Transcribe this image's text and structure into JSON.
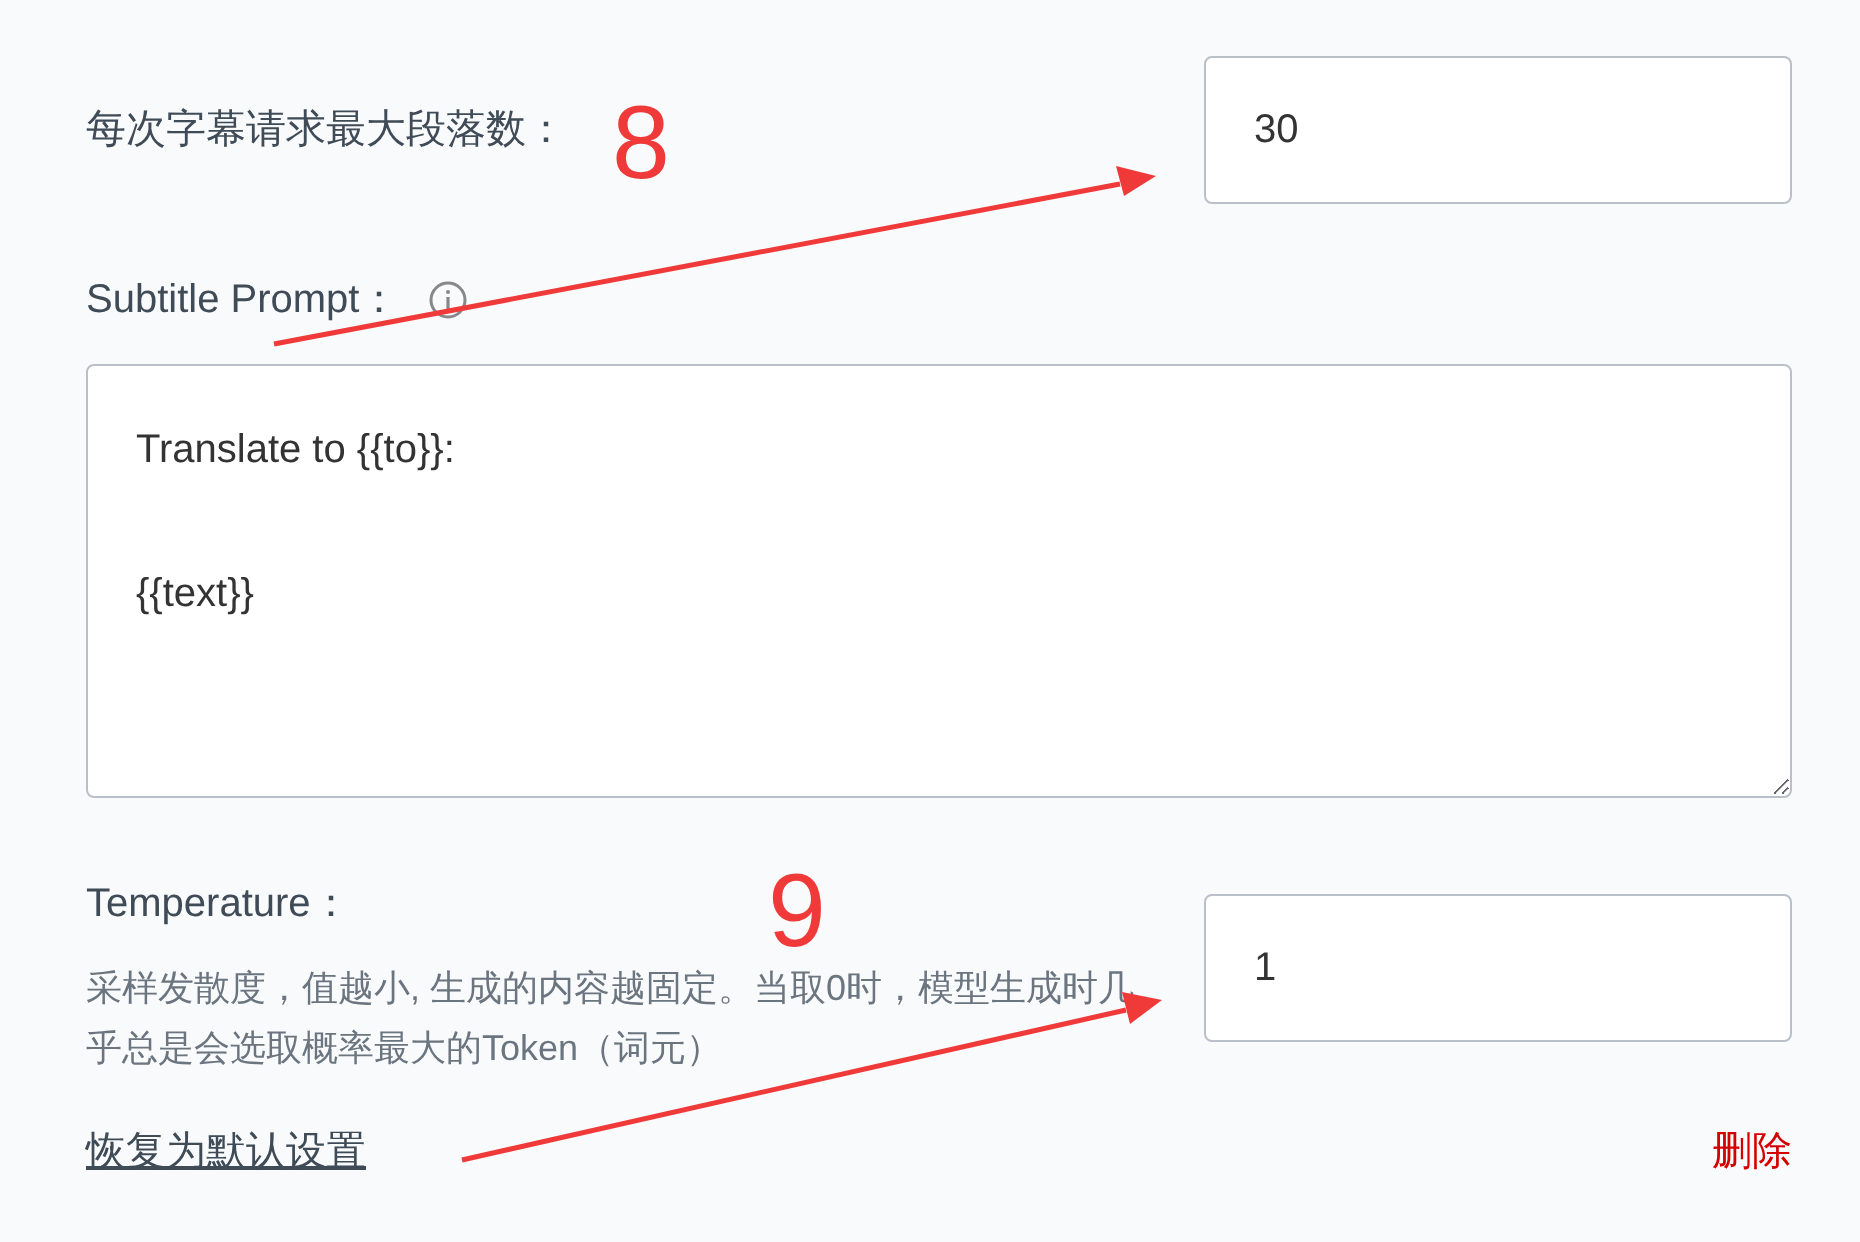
{
  "max_paragraphs": {
    "label": "每次字幕请求最大段落数：",
    "value": "30"
  },
  "subtitle_prompt": {
    "label": "Subtitle Prompt：",
    "value": "Translate to {{to}}:\n\n{{text}}"
  },
  "temperature": {
    "label": "Temperature：",
    "description": "采样发散度，值越小, 生成的内容越固定。当取0时，模型生成时几乎总是会选取概率最大的Token（词元）",
    "value": "1"
  },
  "footer": {
    "reset_link": "恢复为默认设置",
    "delete_link": "删除"
  },
  "annotations": [
    {
      "number": "8"
    },
    {
      "number": "9"
    }
  ]
}
